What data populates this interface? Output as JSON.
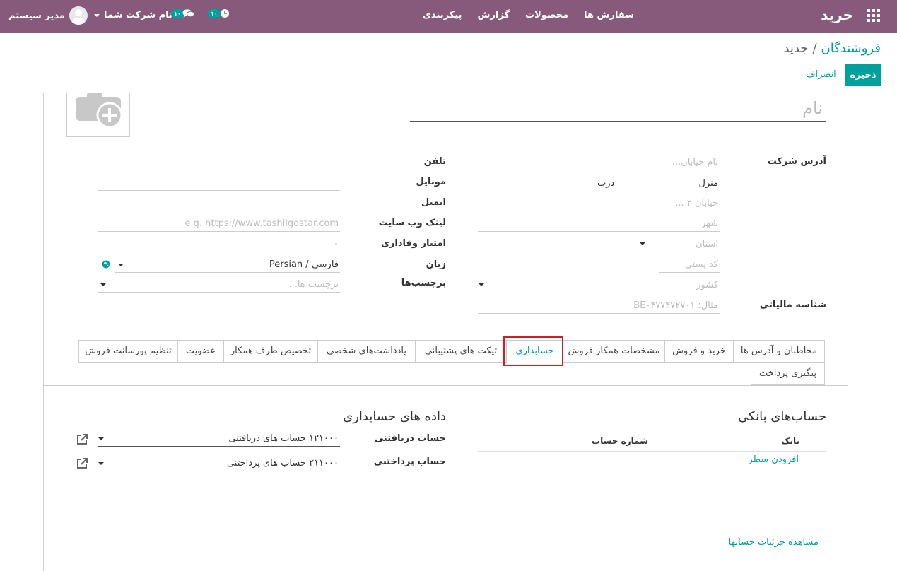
{
  "navbar": {
    "brand": "خرید",
    "menu": [
      "سفارش ها",
      "محصولات",
      "گزارش",
      "پیکربندی"
    ],
    "user_name": "مدیر سیستم",
    "company": "نام شرکت شما",
    "messages_badge": "۱۰",
    "activities_badge": "۱۰",
    "background": "#875a7b"
  },
  "breadcrumb": {
    "parent": "فروشندگان",
    "separator": "/",
    "current": "جدید"
  },
  "buttons": {
    "save": "ذخیره",
    "discard": "انصراف"
  },
  "form": {
    "name_placeholder": "نام",
    "labels": {
      "company_address": "آدرس شرکت",
      "phone": "تلفن",
      "mobile": "موبایل",
      "email": "ایمیل",
      "website": "لینک وب سایت",
      "loyalty": "امتیاز وفاداری",
      "language": "زبان",
      "tags": "برچسب‌ها",
      "tax_id": "شناسه مالیاتی"
    },
    "address": {
      "street_placeholder": "نام خیابان...",
      "house_label": "منزل",
      "door_label": "درب",
      "street2_placeholder": "خیابان ۲ ...",
      "city_placeholder": "شهر",
      "state_placeholder": "استان",
      "zip_placeholder": "کد پستی",
      "country_placeholder": "کشور",
      "tax_placeholder": "مثال: BE۰۴۷۷۴۷۲۷۰۱"
    },
    "website_placeholder": "e.g. https://www.tashilgostar.com",
    "loyalty_value": "۰",
    "language_value": "Persian / فارسی",
    "tags_placeholder": "برچسب ها..."
  },
  "tabs": [
    "مخاطبان و آدرس ها",
    "خرید و فروش",
    "مشخصات همکار فروش",
    "حسابداری",
    "تیکت های پشتیبانی",
    "یادداشت‌های شخصی",
    "تخصیص طرف همکار",
    "عضویت",
    "تنظیم پورسانت فروش",
    "پیگیری پرداخت"
  ],
  "active_tab": "حسابداری",
  "accounting": {
    "bank_title": "حساب‌های بانکی",
    "col_bank": "بانک",
    "col_account_number": "شماره حساب",
    "add_line": "افزودن سطر",
    "data_title": "داده های حسابداری",
    "receivable_label": "حساب دریافتنی",
    "receivable_value": "۱۲۱۰۰۰ حساب های دریافتنی",
    "payable_label": "حساب پرداختنی",
    "payable_value": "۲۱۱۰۰۰ حساب های پرداختنی",
    "details_link": "مشاهده جزئیات حسابها"
  },
  "colors": {
    "accent": "#00a09d",
    "highlight": "#d21e1e"
  }
}
